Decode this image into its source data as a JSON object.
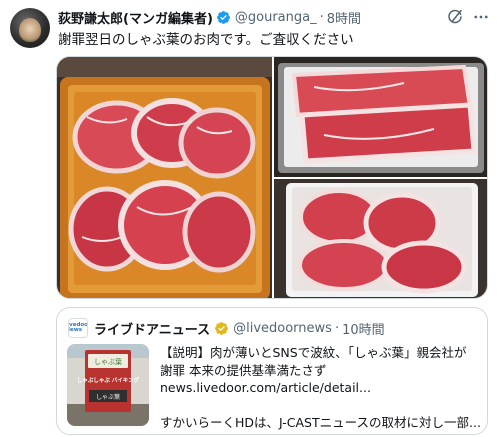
{
  "tweet": {
    "display_name": "荻野謙太郎(マンガ編集者)",
    "handle": "@gouranga_",
    "separator": "·",
    "time": "8時間",
    "text": "謝罪翌日のしゃぶ葉のお肉です。ご査収ください",
    "icons": {
      "verified": "blue-verified-badge-icon",
      "grok": "grok-icon",
      "more": "more-horizontal-icon"
    },
    "media": {
      "photos": [
        {
          "name": "meat-plate-photo-1"
        },
        {
          "name": "meat-plate-photo-2"
        },
        {
          "name": "meat-plate-photo-3"
        }
      ]
    }
  },
  "quote": {
    "avatar_text": "livedoor News",
    "display_name": "ライブドアニュース",
    "handle": "@livedoornews",
    "separator": "·",
    "time": "10時間",
    "lines": [
      "【説明】肉が薄いとSNSで波紋、「しゃぶ葉」親会社が",
      "謝罪 本来の提供基準満たさず",
      "news.livedoor.com/article/detail...",
      "",
      "すかいらーくHDは、J-CASTニュースの取材に対し一部..."
    ],
    "thumbnail": {
      "sign_top": "しゃぶ葉",
      "sign_main": "しゃぶしゃぶ バイキング",
      "sign_bottom": "しゃぶ葉"
    },
    "icons": {
      "verified": "gold-verified-badge-icon"
    }
  },
  "colors": {
    "text": "#0f1419",
    "secondary": "#536471",
    "verified_blue": "#1d9bf0",
    "verified_gold": "#e2b719",
    "border": "#cfd9de"
  }
}
